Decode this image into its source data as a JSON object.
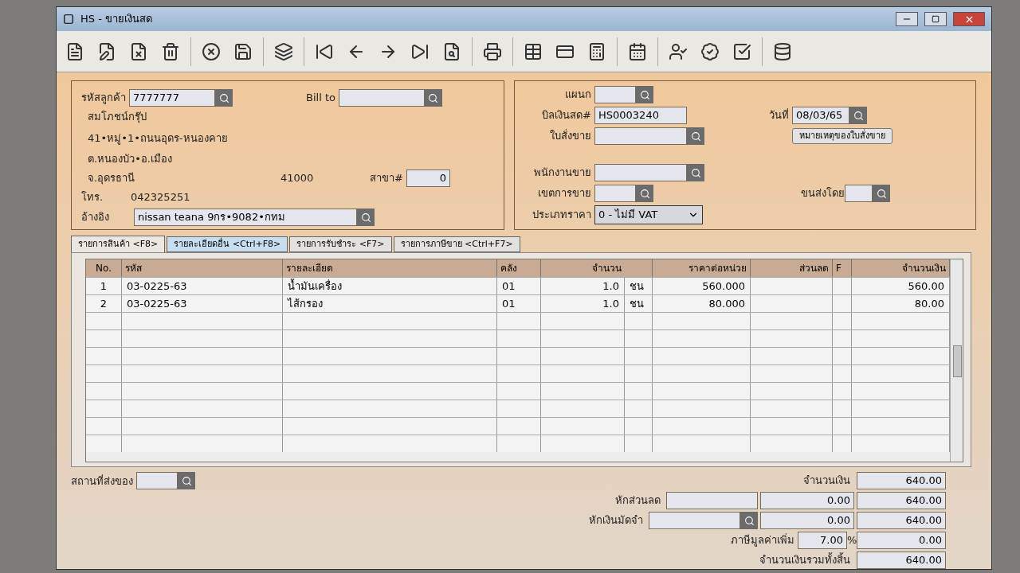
{
  "window": {
    "title": "HS - ขายเงินสด"
  },
  "customer": {
    "code_label": "รหัสลูกค้า",
    "code": "7777777",
    "bill_to_label": "Bill to",
    "name": "สมโภชน์กรุ๊ป",
    "address_1": "41•หมู่•1•ถนนอุดร-หนองคาย",
    "address_2": "ต.หนองบัว•อ.เมือง",
    "province": "จ.อุดรธานี",
    "postcode": "41000",
    "branch_label": "สาขา#",
    "branch": "0",
    "phone_label": "โทร.",
    "phone": "042325251",
    "ref_label": "อ้างอิง",
    "ref": "nissan teana 9กร•9082•กทม"
  },
  "document": {
    "department_label": "แผนก",
    "bill_label": "บิลเงินสด#",
    "bill_no": "HS0003240",
    "date_label": "วันที่",
    "date": "08/03/65",
    "order_label": "ใบสั่งขาย",
    "order_note_button": "หมายเหตุของใบสั่งขาย",
    "salesperson_label": "พนักงานขาย",
    "area_label": "เขตการขาย",
    "shipping_label": "ขนส่งโดย",
    "price_type_label": "ประเภทราคา",
    "price_type": "0 - ไม่มี VAT"
  },
  "tabs": [
    {
      "label": "รายการสินค้า <F8>",
      "selected": true,
      "hovered": false
    },
    {
      "label": "รายละเอียดอื่น <Ctrl+F8>",
      "selected": false,
      "hovered": true
    },
    {
      "label": "รายการรับชำระ <F7>",
      "selected": false,
      "hovered": false
    },
    {
      "label": "รายการภาษีขาย <Ctrl+F7>",
      "selected": false,
      "hovered": false
    }
  ],
  "table": {
    "columns": [
      "No.",
      "รหัส",
      "รายละเอียด",
      "คลัง",
      "จำนวน",
      "",
      "ราคาต่อหน่วย",
      "ส่วนลด",
      "F",
      "จำนวนเงิน"
    ],
    "rows": [
      [
        "1",
        "03-0225-63",
        "น้ำมันเครื่อง",
        "01",
        "1.0",
        "ชน",
        "560.000",
        "",
        "",
        "560.00"
      ],
      [
        "2",
        "03-0225-63",
        "ไส้กรอง",
        "01",
        "1.0",
        "ชน",
        "80.000",
        "",
        "",
        "80.00"
      ]
    ]
  },
  "delivery_label": "สถานที่ส่งของ",
  "totals": {
    "amount_label": "จำนวนเงิน",
    "amount": "640.00",
    "discount_label": "หักส่วนลด",
    "discount": "0.00",
    "after_discount": "640.00",
    "deposit_label": "หักเงินมัดจำ",
    "deposit": "0.00",
    "after_deposit": "640.00",
    "vat_label": "ภาษีมูลค่าเพิ่ม",
    "vat_rate": "7.00",
    "vat_unit": "%",
    "vat": "0.00",
    "grand_total_label": "จำนวนเงินรวมทั้งสิ้น",
    "grand_total": "640.00"
  }
}
